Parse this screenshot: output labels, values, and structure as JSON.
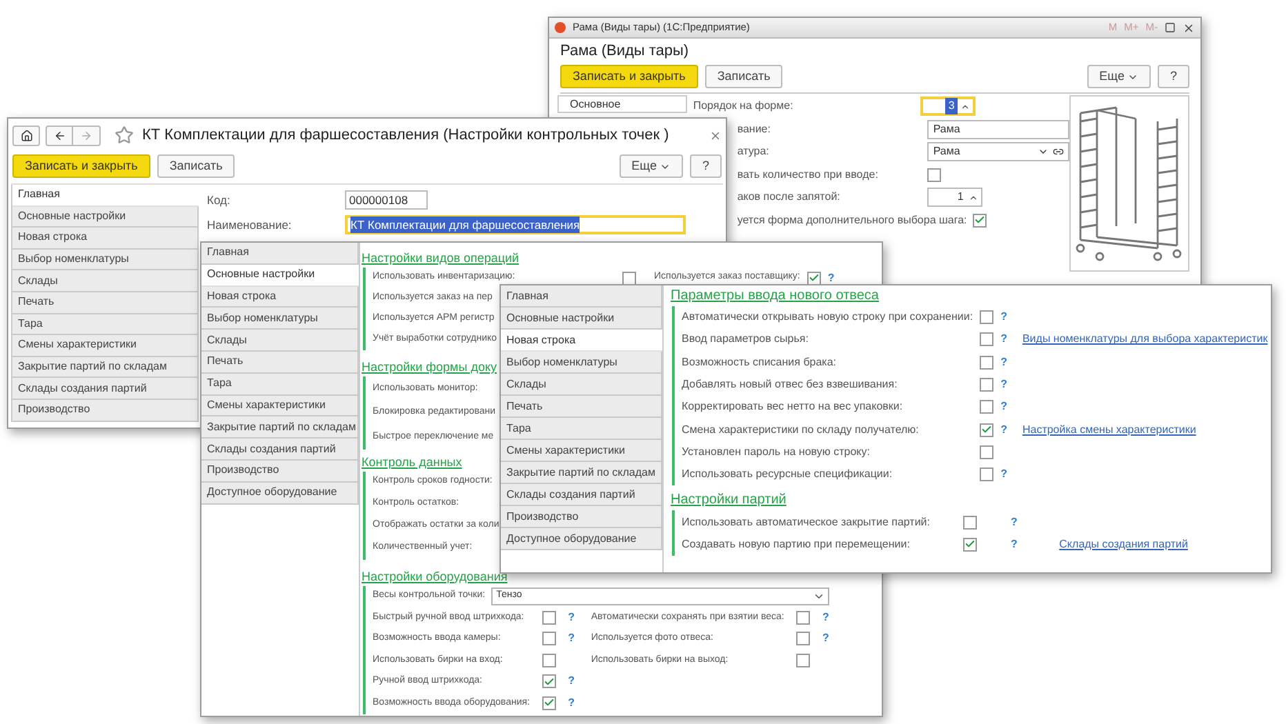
{
  "item_window": {
    "title": "Рама (Виды тары) (1С:Предприятие)",
    "memory_buttons": [
      "M",
      "M+",
      "M-"
    ],
    "heading": "Рама (Виды тары)",
    "primary_button": "Записать и закрыть",
    "secondary_button": "Записать",
    "more_button": "Еще",
    "help_button": "?",
    "tabs": [
      {
        "label": "Основное",
        "selected": true
      }
    ],
    "fields": [
      {
        "label": "Порядок на форме:",
        "kind": "spin",
        "value": "3",
        "focused": true
      },
      {
        "label": "вание:",
        "kind": "text",
        "value": "Рама",
        "focused": false
      },
      {
        "label": "атура:",
        "kind": "dropdown",
        "value": "Рама",
        "focused": false
      },
      {
        "label": "вать количество при вводе:",
        "kind": "checkbox",
        "checked": false
      },
      {
        "label": "аков после запятой:",
        "kind": "spin",
        "value": "1",
        "focused": false
      },
      {
        "label": "уется форма дополнительного выбора шага:",
        "kind": "checkbox",
        "checked": true
      }
    ]
  },
  "settings_window": {
    "title": "КТ Комплектации для фаршесоставления (Настройки контрольных точек )",
    "primary_button": "Записать и закрыть",
    "secondary_button": "Записать",
    "more_button": "Еще",
    "help_button": "?",
    "tabs": [
      {
        "label": "Главная",
        "selected": true
      },
      {
        "label": "Основные настройки",
        "selected": false
      },
      {
        "label": "Новая строка",
        "selected": false
      },
      {
        "label": "Выбор номенклатуры",
        "selected": false
      },
      {
        "label": "Склады",
        "selected": false
      },
      {
        "label": "Печать",
        "selected": false
      },
      {
        "label": "Тара",
        "selected": false
      },
      {
        "label": "Смены характеристики",
        "selected": false
      },
      {
        "label": "Закрытие партий по складам",
        "selected": false
      },
      {
        "label": "Склады создания партий",
        "selected": false
      },
      {
        "label": "Производство",
        "selected": false
      }
    ],
    "fields": [
      {
        "label": "Код:",
        "value": "000000108",
        "focused": false
      },
      {
        "label": "Наименование:",
        "value": "КТ Комплектации для фаршесоставления",
        "focused": true
      }
    ]
  },
  "general_panel": {
    "tabs": [
      {
        "label": "Главная",
        "selected": false
      },
      {
        "label": "Основные настройки",
        "selected": true
      },
      {
        "label": "Новая строка",
        "selected": false
      },
      {
        "label": "Выбор номенклатуры",
        "selected": false
      },
      {
        "label": "Склады",
        "selected": false
      },
      {
        "label": "Печать",
        "selected": false
      },
      {
        "label": "Тара",
        "selected": false
      },
      {
        "label": "Смены характеристики",
        "selected": false
      },
      {
        "label": "Закрытие партий по складам",
        "selected": false
      },
      {
        "label": "Склады создания партий",
        "selected": false
      },
      {
        "label": "Производство",
        "selected": false
      },
      {
        "label": "Доступное оборудование",
        "selected": false
      }
    ],
    "sections": [
      {
        "title": "Настройки видов операций",
        "rows": [
          {
            "kind": "checkbox",
            "label": "Использовать инвентаризацию:",
            "checked": false,
            "right": {
              "label": "Используется заказ поставщику:",
              "checked": true,
              "help": "?"
            }
          },
          {
            "kind": "label",
            "label": "Используется заказ на пер"
          },
          {
            "kind": "label",
            "label": "Используется АРМ регистр"
          },
          {
            "kind": "label",
            "label": "Учёт выработки сотруднико"
          }
        ]
      },
      {
        "title": "Настройки формы доку",
        "rows": [
          {
            "kind": "label",
            "label": "Использовать монитор:"
          },
          {
            "kind": "label",
            "label": "Блокировка редактировани"
          },
          {
            "kind": "label",
            "label": "Быстрое переключение ме"
          }
        ]
      },
      {
        "title": "Контроль данных",
        "rows": [
          {
            "kind": "label",
            "label": "Контроль сроков годности:"
          },
          {
            "kind": "label",
            "label": "Контроль остатков:"
          },
          {
            "kind": "label",
            "label": "Отображать остатки за коли"
          },
          {
            "kind": "label",
            "label": "Количественный учет:"
          }
        ]
      },
      {
        "title": "Настройки оборудования",
        "rows": [
          {
            "kind": "dropdown",
            "label": "Весы контрольной точки:",
            "value": "Тензо"
          },
          {
            "kind": "checkbox",
            "label": "Быстрый ручной ввод штрихкода:",
            "checked": false,
            "help": "?",
            "right": {
              "label": "Автоматически сохранять при взятии веса:",
              "checked": false,
              "help": "?"
            }
          },
          {
            "kind": "checkbox",
            "label": "Возможность ввода камеры:",
            "checked": false,
            "help": "?",
            "right": {
              "label": "Используется фото отвеса:",
              "checked": false,
              "help": "?"
            }
          },
          {
            "kind": "checkbox",
            "label": "Использовать бирки на вход:",
            "checked": false,
            "right": {
              "label": "Использовать бирки на выход:",
              "checked": false
            }
          },
          {
            "kind": "checkbox",
            "label": "Ручной ввод штрихкода:",
            "checked": true,
            "help": "?"
          },
          {
            "kind": "checkbox",
            "label": "Возможность ввода оборудования:",
            "checked": true,
            "help": "?"
          }
        ]
      }
    ]
  },
  "new_row_panel": {
    "tabs": [
      {
        "label": "Главная",
        "selected": false
      },
      {
        "label": "Основные настройки",
        "selected": false
      },
      {
        "label": "Новая строка",
        "selected": true
      },
      {
        "label": "Выбор номенклатуры",
        "selected": false
      },
      {
        "label": "Склады",
        "selected": false
      },
      {
        "label": "Печать",
        "selected": false
      },
      {
        "label": "Тара",
        "selected": false
      },
      {
        "label": "Смены характеристики",
        "selected": false
      },
      {
        "label": "Закрытие партий по складам",
        "selected": false
      },
      {
        "label": "Склады создания партий",
        "selected": false
      },
      {
        "label": "Производство",
        "selected": false
      },
      {
        "label": "Доступное оборудование",
        "selected": false
      }
    ],
    "sections": [
      {
        "title": "Параметры ввода нового отвеса",
        "rows": [
          {
            "kind": "checkbox",
            "label": "Автоматически открывать новую строку при сохранении:",
            "checked": false,
            "help": "?"
          },
          {
            "kind": "checkbox",
            "label": "Ввод параметров сырья:",
            "checked": false,
            "help": "?",
            "link": "Виды номенклатуры для выбора характеристик"
          },
          {
            "kind": "checkbox",
            "label": "Возможность списания брака:",
            "checked": false,
            "help": "?"
          },
          {
            "kind": "checkbox",
            "label": "Добавлять новый отвес без взвешивания:",
            "checked": false,
            "help": "?"
          },
          {
            "kind": "checkbox",
            "label": "Корректировать вес нетто на вес упаковки:",
            "checked": false,
            "help": "?"
          },
          {
            "kind": "checkbox",
            "label": "Смена характеристики по складу получателю:",
            "checked": true,
            "help": "?",
            "link": "Настройка смены характеристики"
          },
          {
            "kind": "checkbox",
            "label": "Установлен пароль на новую строку:",
            "checked": false
          },
          {
            "kind": "checkbox",
            "label": "Использовать ресурсные спецификации:",
            "checked": false,
            "help": "?"
          }
        ]
      },
      {
        "title": "Настройки партий",
        "rows": [
          {
            "kind": "checkbox",
            "label": "Использовать автоматическое закрытие партий:",
            "checked": false,
            "help": "?"
          },
          {
            "kind": "checkbox",
            "label": "Создавать новую партию при перемещении:",
            "checked": true,
            "help": "?",
            "link": "Склады создания партий"
          }
        ]
      }
    ]
  }
}
